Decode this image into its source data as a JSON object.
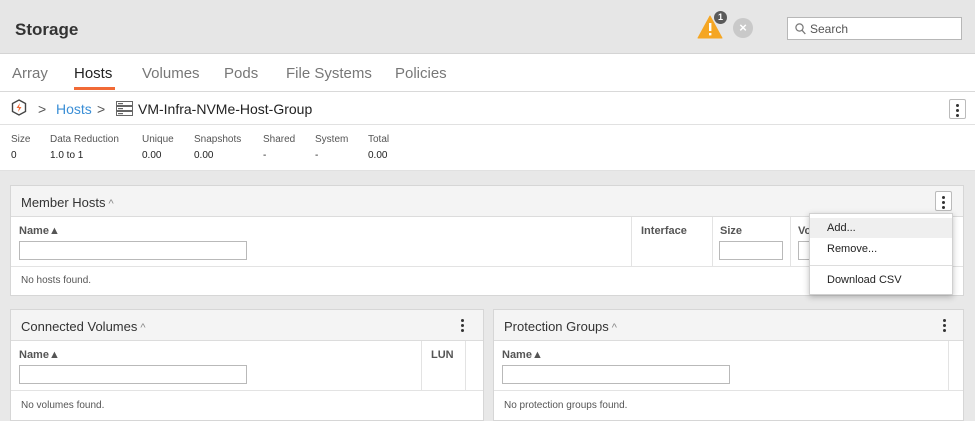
{
  "header": {
    "title": "Storage",
    "warning_count": "1",
    "error_symbol": "×",
    "search_placeholder": "Search"
  },
  "tabs": [
    "Array",
    "Hosts",
    "Volumes",
    "Pods",
    "File Systems",
    "Policies"
  ],
  "active_tab": "Hosts",
  "breadcrumb": {
    "sep": ">",
    "hosts": "Hosts",
    "current": "VM-Infra-NVMe-Host-Group"
  },
  "stats": [
    {
      "label": "Size",
      "value": "0"
    },
    {
      "label": "Data Reduction",
      "value": "1.0 to 1"
    },
    {
      "label": "Unique",
      "value": "0.00"
    },
    {
      "label": "Snapshots",
      "value": "0.00"
    },
    {
      "label": "Shared",
      "value": "-"
    },
    {
      "label": "System",
      "value": "-"
    },
    {
      "label": "Total",
      "value": "0.00"
    }
  ],
  "member_hosts": {
    "title": "Member Hosts",
    "caret": "^",
    "columns": [
      "Name▲",
      "Interface",
      "Size",
      "Vo"
    ],
    "empty": "No hosts found."
  },
  "connected_volumes": {
    "title": "Connected Volumes",
    "caret": "^",
    "columns": [
      "Name▲",
      "LUN"
    ],
    "empty": "No volumes found."
  },
  "protection_groups": {
    "title": "Protection Groups",
    "caret": "^",
    "columns": [
      "Name▲"
    ],
    "empty": "No protection groups found."
  },
  "context_menu": {
    "items": [
      "Add...",
      "Remove...",
      "Download CSV"
    ]
  },
  "colors": {
    "accent": "#f16a36",
    "link": "#3a8ed6",
    "warning": "#f5a623"
  }
}
